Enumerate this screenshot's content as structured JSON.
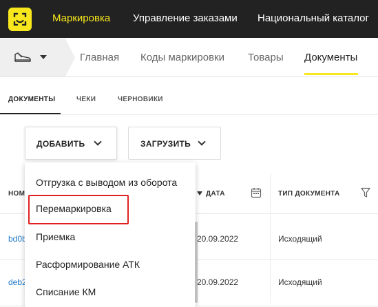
{
  "topbar": {
    "nav": [
      "Маркировка",
      "Управление заказами",
      "Национальный каталог"
    ],
    "active": "Маркировка"
  },
  "subbar": {
    "product_icon": "sneaker-icon",
    "nav": [
      "Главная",
      "Коды маркировки",
      "Товары",
      "Документы"
    ],
    "active": "Документы"
  },
  "tabs": [
    "ДОКУМЕНТЫ",
    "ЧЕКИ",
    "ЧЕРНОВИКИ"
  ],
  "actions": {
    "add_label": "ДОБАВИТЬ",
    "upload_label": "ЗАГРУЗИТЬ"
  },
  "table": {
    "headers": {
      "number": "НОМ",
      "date": "ДАТА",
      "doc_type": "ТИП ДОКУМЕНТА"
    },
    "rows": [
      {
        "number": "bd0b",
        "date": "20.09.2022",
        "doc_type": "Исходящий"
      },
      {
        "number": "deb2",
        "date": "20.09.2022",
        "doc_type": "Исходящий"
      }
    ]
  },
  "dropdown": {
    "items": [
      "Отгрузка с выводом из оборота",
      "Перемаркировка",
      "Приемка",
      "Расформирование АТК",
      "Списание КМ"
    ],
    "highlighted": "Перемаркировка"
  },
  "colors": {
    "topbar_bg": "#222222",
    "accent": "#f8e71c",
    "link": "#1f7ac8",
    "highlight": "#e02020"
  }
}
